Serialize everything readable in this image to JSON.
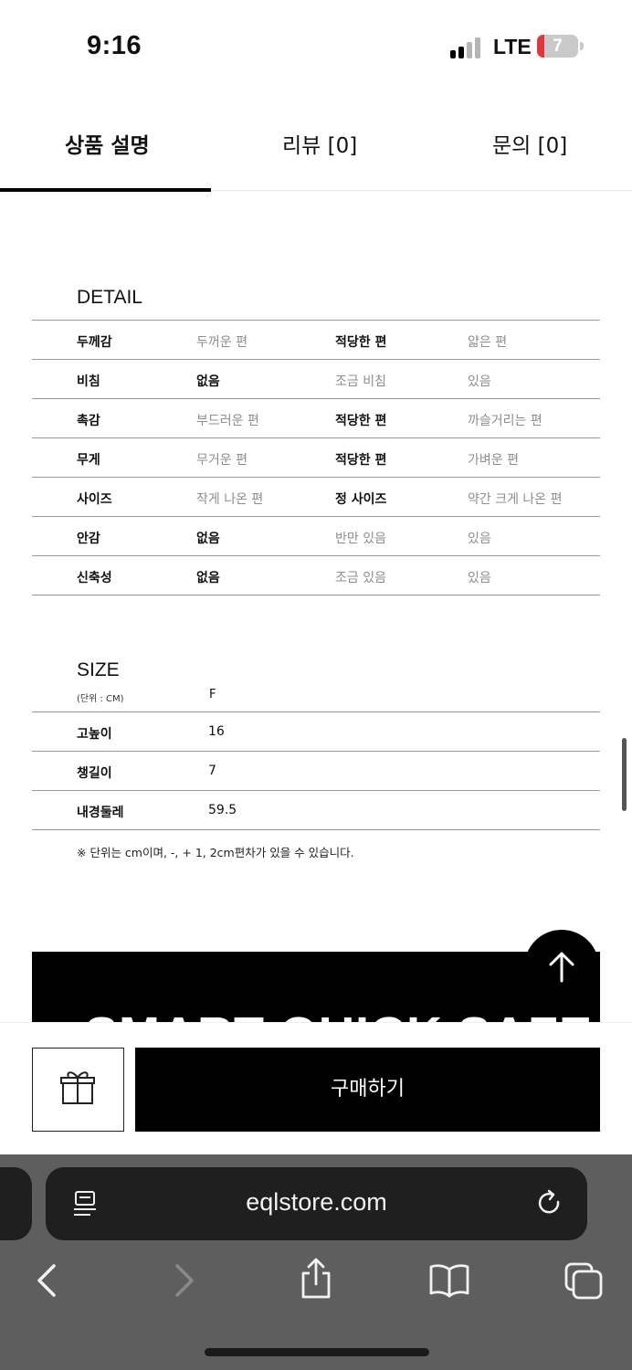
{
  "status_bar": {
    "time": "9:16",
    "network": "LTE",
    "battery": "7"
  },
  "tabs": [
    {
      "label": "상품 설명",
      "active": true
    },
    {
      "label": "리뷰 [0]",
      "active": false
    },
    {
      "label": "문의 [0]",
      "active": false
    }
  ],
  "detail": {
    "title": "DETAIL",
    "rows": [
      {
        "label": "두께감",
        "options": [
          "두꺼운 편",
          "적당한 편",
          "얇은 편"
        ],
        "selected": 1
      },
      {
        "label": "비침",
        "options": [
          "없음",
          "조금 비침",
          "있음"
        ],
        "selected": 0
      },
      {
        "label": "촉감",
        "options": [
          "부드러운 편",
          "적당한 편",
          "까슬거리는 편"
        ],
        "selected": 1
      },
      {
        "label": "무게",
        "options": [
          "무거운 편",
          "적당한 편",
          "가벼운 편"
        ],
        "selected": 1
      },
      {
        "label": "사이즈",
        "options": [
          "작게 나온 편",
          "정 사이즈",
          "약간 크게 나온 편"
        ],
        "selected": 1
      },
      {
        "label": "안감",
        "options": [
          "없음",
          "반만 있음",
          "있음"
        ],
        "selected": 0
      },
      {
        "label": "신축성",
        "options": [
          "없음",
          "조금 있음",
          "있음"
        ],
        "selected": 0
      }
    ]
  },
  "size": {
    "title": "SIZE",
    "unit_label": "(단위 : CM)",
    "column": "F",
    "rows": [
      {
        "label": "고높이",
        "value": "16"
      },
      {
        "label": "챙길이",
        "value": "7"
      },
      {
        "label": "내경둘레",
        "value": "59.5"
      }
    ],
    "note": "※ 단위는 cm이며, -, + 1, 2cm편차가 있을 수 있습니다."
  },
  "banner": {
    "text": "SMART QUICK SAFE"
  },
  "actions": {
    "gift_icon": "gift-icon",
    "buy_label": "구매하기",
    "scroll_top_icon": "arrow-up-icon"
  },
  "browser": {
    "url": "eqlstore.com"
  }
}
